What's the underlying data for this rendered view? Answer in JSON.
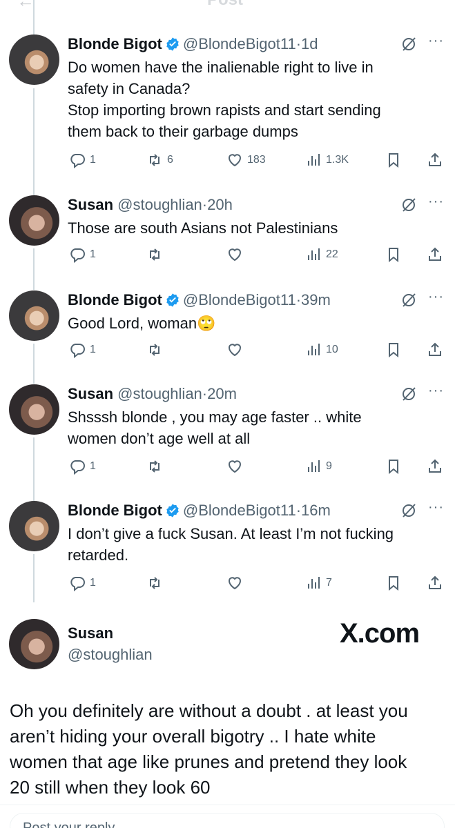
{
  "header": {
    "back_glyph": "←",
    "title": "Post"
  },
  "tweets": [
    {
      "name": "Blonde Bigot",
      "verified": true,
      "handle": "@BlondeBigot11",
      "time": "1d",
      "text_lines": [
        "Do women have the inalienable right to live in",
        "safety in Canada?",
        "Stop importing brown rapists and start sending",
        "them back to their garbage dumps"
      ],
      "replies": "1",
      "reposts": "6",
      "likes": "183",
      "views": "1.3K"
    },
    {
      "name": "Susan",
      "verified": false,
      "handle": "@stoughlian",
      "time": "20h",
      "text_lines": [
        "Those are south Asians not Palestinians"
      ],
      "replies": "1",
      "reposts": "",
      "likes": "",
      "views": "22"
    },
    {
      "name": "Blonde Bigot",
      "verified": true,
      "handle": "@BlondeBigot11",
      "time": "39m",
      "text_lines": [
        "Good Lord, woman🙄"
      ],
      "replies": "1",
      "reposts": "",
      "likes": "",
      "views": "10"
    },
    {
      "name": "Susan",
      "verified": false,
      "handle": "@stoughlian",
      "time": "20m",
      "text_lines": [
        "Shsssh blonde , you may age faster .. white",
        "women don’t age well at all"
      ],
      "replies": "1",
      "reposts": "",
      "likes": "",
      "views": "9"
    },
    {
      "name": "Blonde Bigot",
      "verified": true,
      "handle": "@BlondeBigot11",
      "time": "16m",
      "text_lines": [
        "I don’t give a fuck Susan. At least I’m not fucking",
        "retarded."
      ],
      "replies": "1",
      "reposts": "",
      "likes": "",
      "views": "7"
    }
  ],
  "main_post": {
    "name": "Susan",
    "handle": "@stoughlian",
    "watermark": "X.com",
    "text_lines": [
      "Oh you definitely are without a doubt . at least you",
      "aren’t hiding your overall bigotry .. I hate white",
      "women that age like prunes and pretend they look",
      "20 still when they look 60"
    ]
  },
  "reply_bar": {
    "placeholder": "Post your reply"
  },
  "icons": {
    "verified": "verified-badge-icon",
    "grok": "grok-icon",
    "more": "more-icon",
    "reply": "reply-icon",
    "repost": "repost-icon",
    "like": "like-icon",
    "views": "views-icon",
    "bookmark": "bookmark-icon",
    "share": "share-icon"
  },
  "colors": {
    "text": "#0f1419",
    "secondary": "#536471",
    "verified": "#1d9bf0",
    "line": "#cfd9de"
  }
}
